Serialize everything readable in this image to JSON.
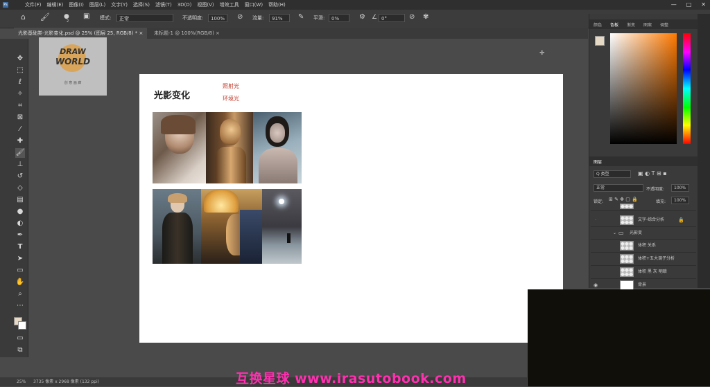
{
  "menubar": {
    "ps_logo": "Ps",
    "items": [
      "文件(F)",
      "编辑(E)",
      "图像(I)",
      "图层(L)",
      "文字(Y)",
      "选择(S)",
      "滤镜(T)",
      "3D(D)",
      "视图(V)",
      "增效工具",
      "窗口(W)",
      "帮助(H)"
    ],
    "window_controls": [
      "—",
      "□",
      "✕"
    ]
  },
  "options_bar": {
    "mode_label": "模式:",
    "mode_value": "正常",
    "opacity_label": "不透明度:",
    "opacity_value": "100%",
    "flow_label": "流量:",
    "flow_value": "91%",
    "smooth_label": "平滑:",
    "smooth_value": "0%",
    "angle_value": "0°",
    "brush_size": "2"
  },
  "tabs": [
    {
      "label": "光影基础类-光影变化.psd @ 25% (图层 25, RGB/8) *",
      "active": true
    },
    {
      "label": "未标题-1 @ 100%(RGB/8)",
      "active": false
    }
  ],
  "logo": {
    "line1": "DRAW",
    "line2": "WORLD",
    "caption": "创 意 画 廊"
  },
  "canvas": {
    "title": "光影变化",
    "note1": "照射光",
    "note2": "环境光"
  },
  "right_panel": {
    "color_tabs": [
      "颜色",
      "色板",
      "渐变",
      "图案",
      "调整"
    ],
    "layer_tabs": [
      "图层"
    ],
    "filter_label": "Q 类型",
    "blend_mode": "正常",
    "opacity_label": "不透明度:",
    "opacity_value": "100%",
    "lock_label": "锁定:",
    "fill_label": "填充:",
    "fill_value": "100%",
    "layers": [
      "",
      "文字-综合分析",
      "光影变",
      "体积 关系",
      "体积+五大调子分析",
      "体积 黑 灰 明暗",
      "背景"
    ],
    "colors": {
      "accent": "#3b6ea8",
      "fg": "#e6d9c6",
      "bg": "#ffffff"
    }
  },
  "statusbar": {
    "zoom": "25%",
    "doc": "3735 像素 x 2968 像素 (132 ppi)"
  },
  "watermark": "互换星球 www.irasutobook.com",
  "tools": [
    "move-icon",
    "marquee-icon",
    "lasso-icon",
    "magic-wand-icon",
    "crop-icon",
    "frame-icon",
    "eyedropper-icon",
    "healing-icon",
    "brush-icon",
    "stamp-icon",
    "history-brush-icon",
    "eraser-icon",
    "gradient-icon",
    "blur-icon",
    "dodge-icon",
    "pen-icon",
    "type-icon",
    "path-select-icon",
    "shape-icon",
    "hand-icon",
    "zoom-icon",
    "more-icon"
  ]
}
